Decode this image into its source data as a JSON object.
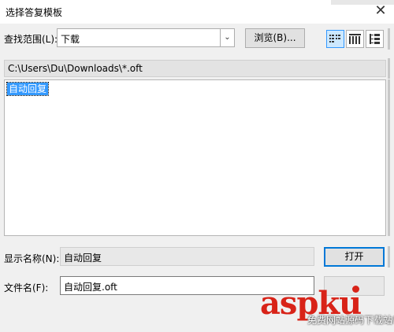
{
  "window": {
    "title": "选择答复模板",
    "close_glyph": "✕"
  },
  "lookin": {
    "label": "查找范围(L):",
    "value": "下载",
    "arrow_glyph": "⌄"
  },
  "toolbar": {
    "browse_label": "浏览(B)...",
    "view_list_icon": "list-view-icon",
    "view_details_icon": "details-view-icon",
    "view_tree_icon": "tree-view-icon"
  },
  "path": {
    "text": "C:\\Users\\Du\\Downloads\\*.oft"
  },
  "files": {
    "items": [
      {
        "name": "自动回复",
        "selected": true
      }
    ]
  },
  "display_name": {
    "label": "显示名称(N):",
    "value": "自动回复"
  },
  "filename": {
    "label": "文件名(F):",
    "value": "自动回复.oft"
  },
  "buttons": {
    "open_label": "打开"
  },
  "watermark": {
    "main": "aspku",
    "sub": "免费网站源码下载站!"
  },
  "colors": {
    "selection": "#3399ff",
    "watermark": "#d82318"
  }
}
